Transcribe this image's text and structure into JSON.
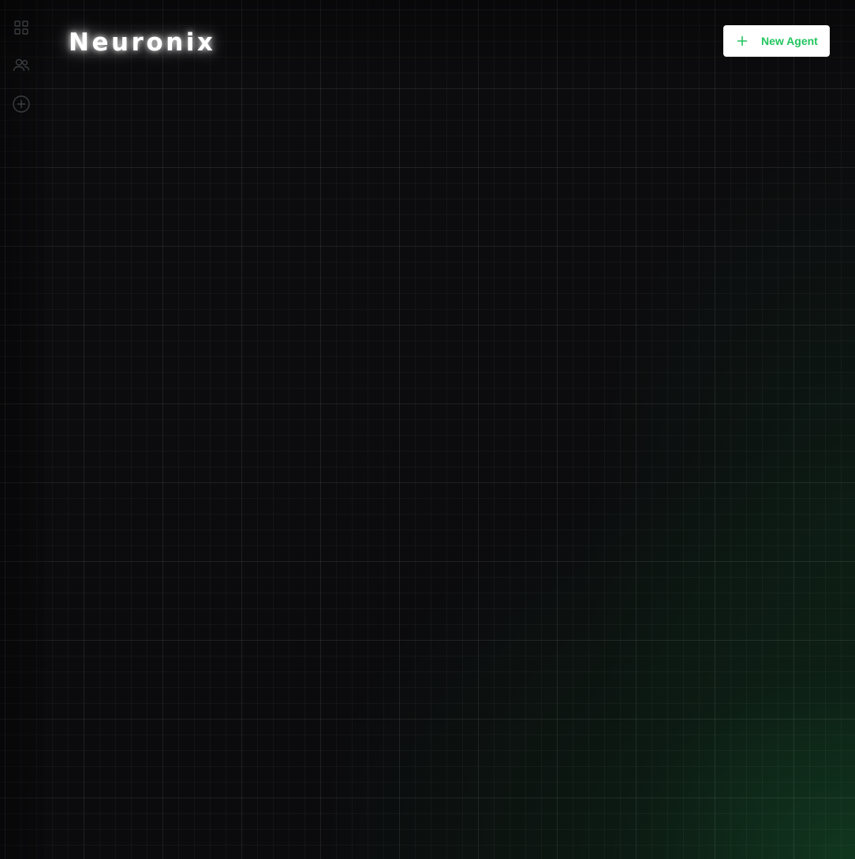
{
  "app": {
    "brand": "Neuronix",
    "accent_color": "#22c55e",
    "background_color": "#0b0b0d"
  },
  "sidebar": {
    "items": [
      {
        "icon": "grid-icon"
      },
      {
        "icon": "users-icon"
      },
      {
        "icon": "plus-circle-icon"
      }
    ]
  },
  "header": {
    "new_agent_label": "New Agent",
    "new_agent_icon": "plus-icon"
  }
}
